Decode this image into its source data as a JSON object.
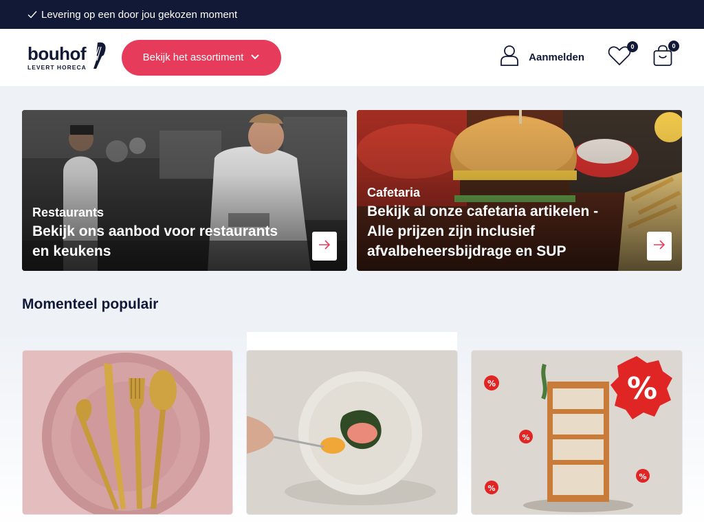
{
  "topbar": {
    "text": "Levering op een door jou gekozen moment",
    "icon": "check-icon"
  },
  "header": {
    "logo": {
      "word": "bouhof",
      "sub": "LEVERT HORECA"
    },
    "assortment_button": "Bekijk het assortiment",
    "login_label": "Aanmelden",
    "wishlist_count": "0",
    "cart_count": "0"
  },
  "banners": [
    {
      "category": "Restaurants",
      "title_line1": "Bekijk ons aanbod voor restaurants",
      "title_line2": "en keukens"
    },
    {
      "category": "Cafetaria",
      "title_line1": "Bekijk al onze cafetaria artikelen -",
      "title_line2": "Alle prijzen zijn inclusief",
      "title_line3": "afvalbeheersbijdrage en SUP"
    }
  ],
  "popular": {
    "title": "Momenteel populair"
  },
  "colors": {
    "navy": "#111936",
    "accent": "#e63b5a",
    "background": "#eef1f6"
  }
}
